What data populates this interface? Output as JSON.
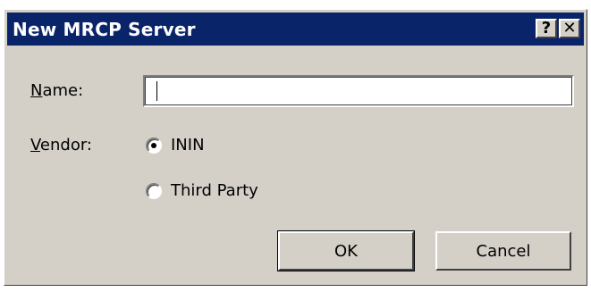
{
  "window": {
    "title": "New MRCP Server",
    "help_button": "?",
    "close_button": "✕"
  },
  "form": {
    "name_label_accel": "N",
    "name_label_rest": "ame:",
    "name_value": "",
    "vendor_label_accel": "V",
    "vendor_label_rest": "endor:",
    "vendor_options": [
      {
        "label": "ININ",
        "selected": true
      },
      {
        "label": "Third Party",
        "selected": false
      }
    ]
  },
  "buttons": {
    "ok": "OK",
    "cancel": "Cancel"
  },
  "colors": {
    "titlebar": "#0a246a",
    "dialog_bg": "#d4d0c8"
  }
}
